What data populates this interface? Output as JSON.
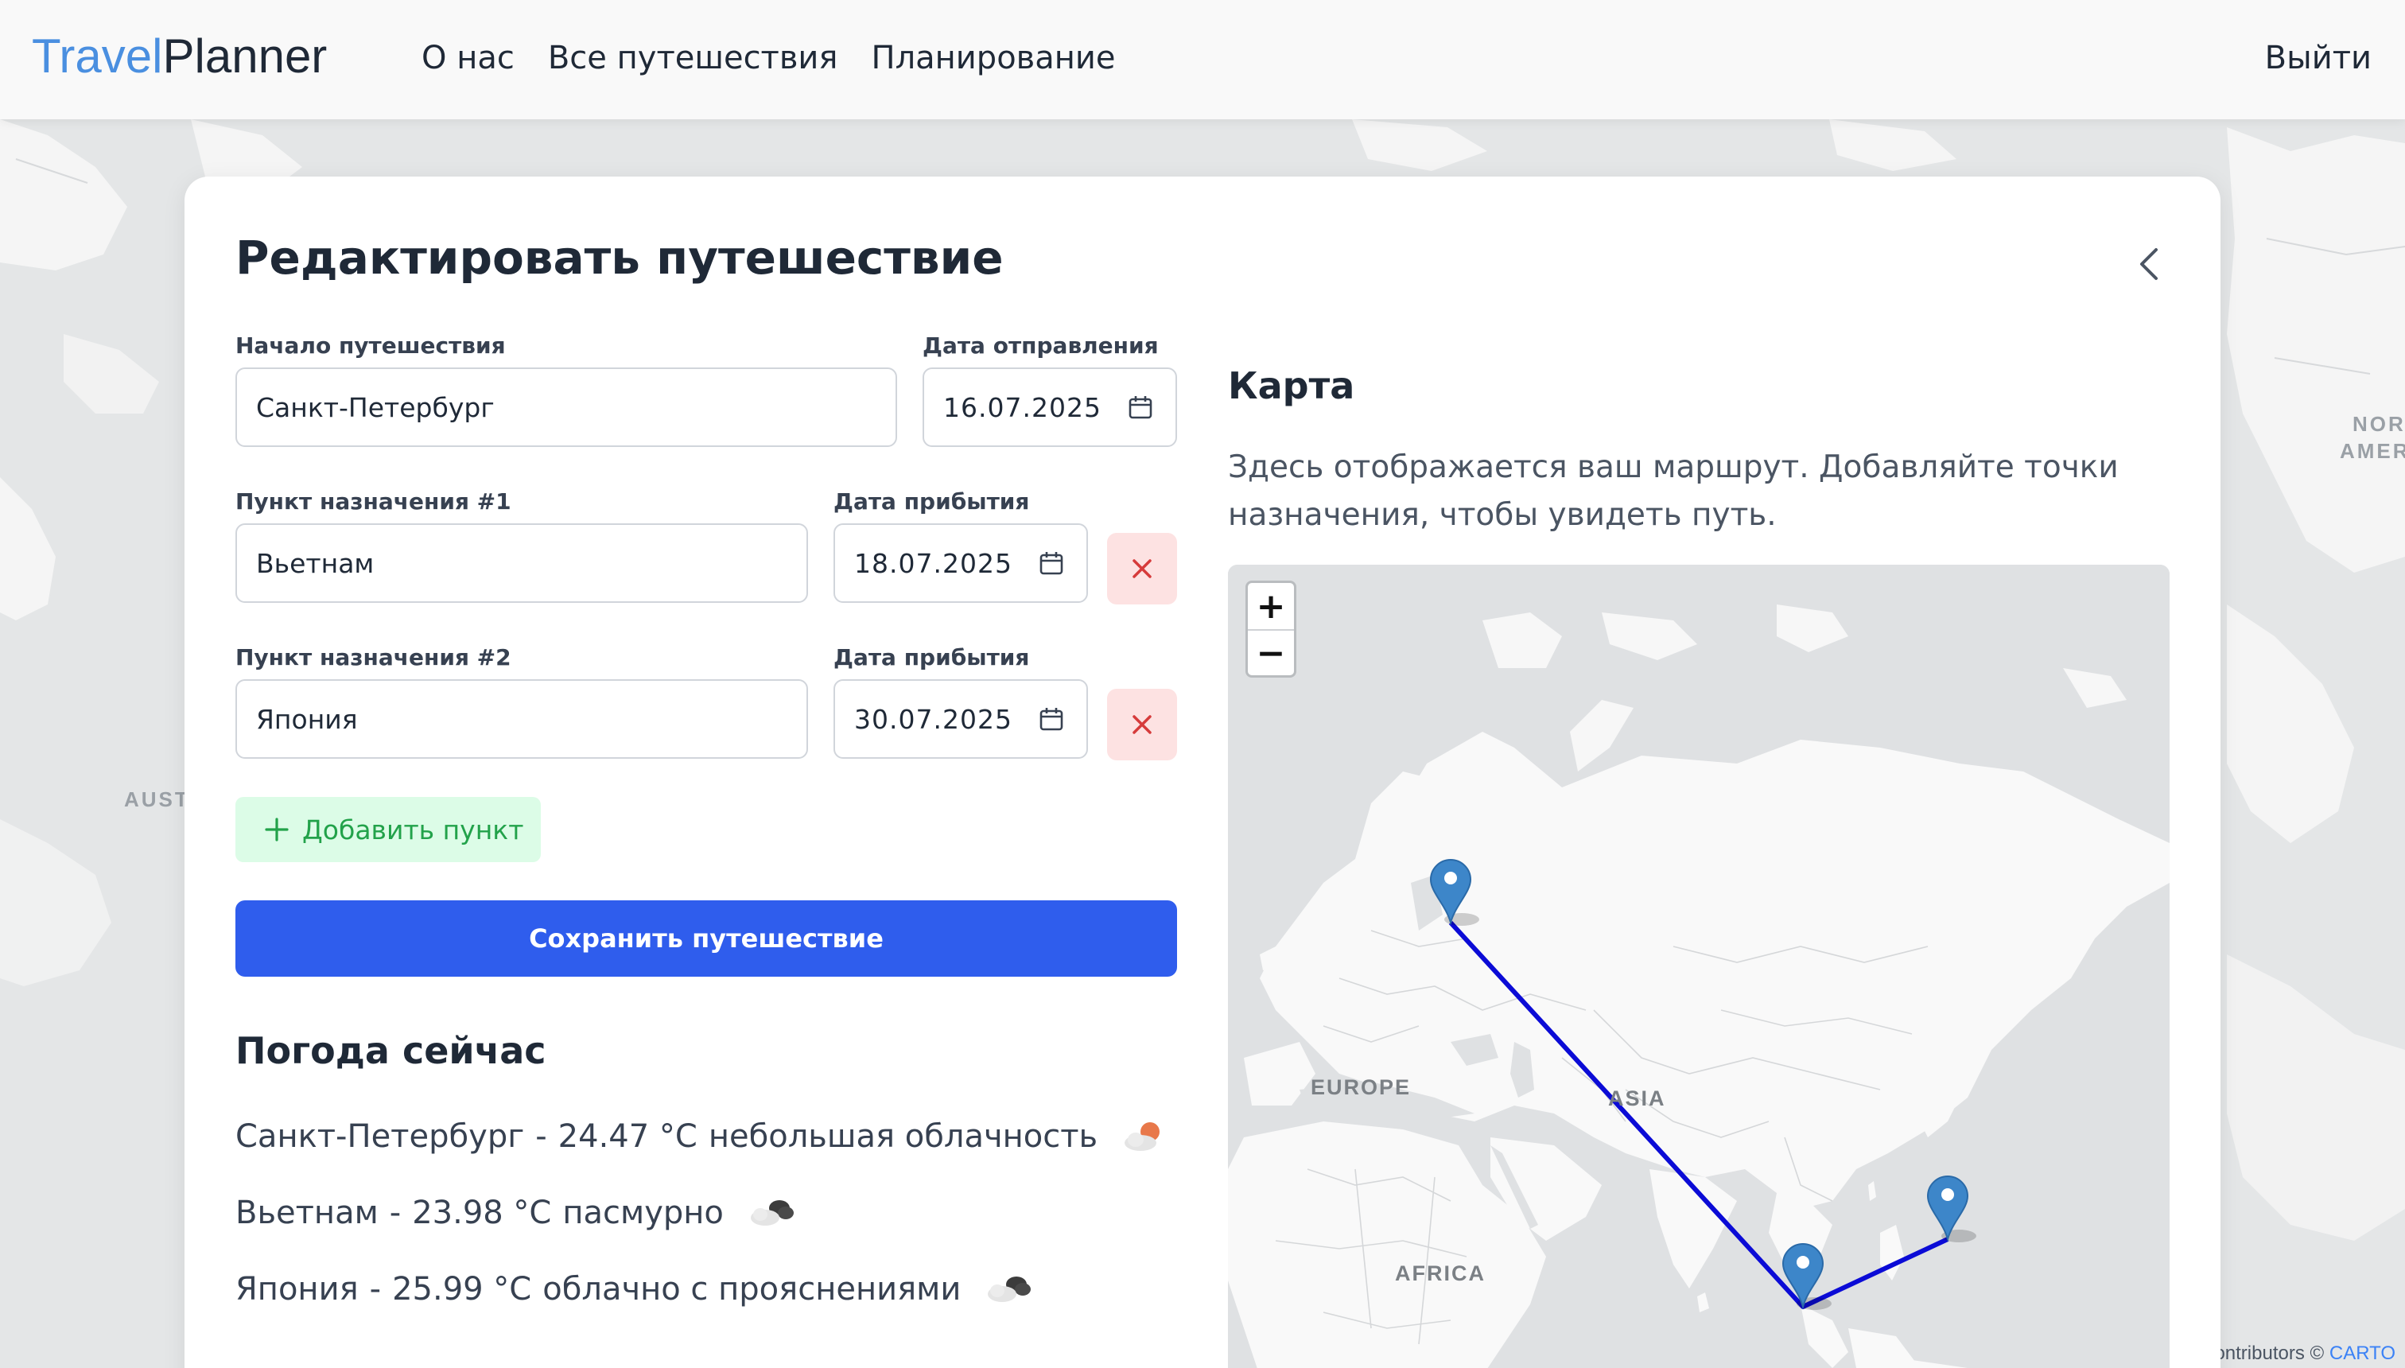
{
  "header": {
    "logo_part1": "Travel",
    "logo_part2": "Planner",
    "nav": [
      "О нас",
      "Все путешествия",
      "Планирование"
    ],
    "logout": "Выйти"
  },
  "background_map": {
    "labels": {
      "australia": "AUST",
      "north_america_1": "NOR",
      "north_america_2": "AMER"
    },
    "attribution_prefix": "ontributors © ",
    "attribution_link": "CARTO"
  },
  "form": {
    "title": "Редактировать путешествие",
    "start": {
      "label": "Начало путешествия",
      "value": "Санкт-Петербург",
      "date_label": "Дата отправления",
      "date": "16.07.2025"
    },
    "destinations": [
      {
        "label": "Пункт назначения #1",
        "value": "Вьетнам",
        "date_label": "Дата прибытия",
        "date": "18.07.2025"
      },
      {
        "label": "Пункт назначения #2",
        "value": "Япония",
        "date_label": "Дата прибытия",
        "date": "30.07.2025"
      }
    ],
    "add_point": "Добавить пункт",
    "save": "Сохранить путешествие"
  },
  "weather": {
    "title": "Погода сейчас",
    "items": [
      {
        "city": "Санкт-Петербург",
        "separator": "-",
        "temp": "24.47 °C",
        "desc": "небольшая облачность",
        "icon": "partly-cloudy-sun-icon"
      },
      {
        "city": "Вьетнам",
        "separator": "-",
        "temp": "23.98 °C",
        "desc": "пасмурно",
        "icon": "overcast-clouds-icon"
      },
      {
        "city": "Япония",
        "separator": "-",
        "temp": "25.99 °C",
        "desc": "облачно с прояснениями",
        "icon": "broken-clouds-icon"
      }
    ]
  },
  "map": {
    "title": "Карта",
    "description": "Здесь отображается ваш маршрут. Добавляйте точки назначения, чтобы увидеть путь.",
    "zoom_in": "+",
    "zoom_out": "−",
    "labels": {
      "europe": "EUROPE",
      "asia": "ASIA",
      "africa": "AFRICA"
    },
    "route_color": "#0b0bd6",
    "marker_color": "#3d86c9"
  },
  "colors": {
    "primary": "#2f5ded",
    "add_green": "#22a24a",
    "remove_red": "#d63b3b",
    "logo_blue": "#4a8fe0"
  }
}
